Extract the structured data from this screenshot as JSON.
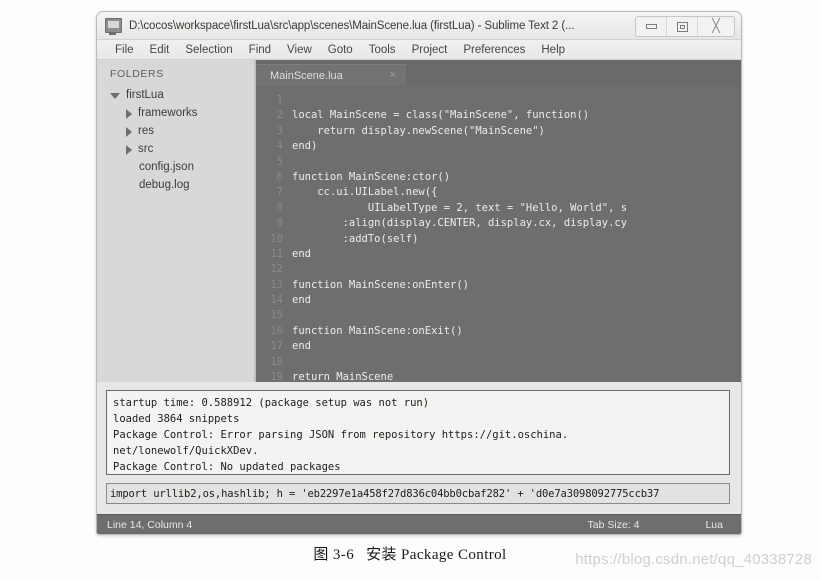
{
  "window": {
    "title": "D:\\cocos\\workspace\\firstLua\\src\\app\\scenes\\MainScene.lua (firstLua) - Sublime Text 2 (...",
    "icon": "app-window-icon",
    "controls": {
      "minimize": "minimize-icon",
      "maximize": "maximize-icon",
      "close": "close-icon"
    }
  },
  "menubar": {
    "items": [
      "File",
      "Edit",
      "Selection",
      "Find",
      "View",
      "Goto",
      "Tools",
      "Project",
      "Preferences",
      "Help"
    ]
  },
  "sidebar": {
    "header": "FOLDERS",
    "tree": [
      {
        "label": "firstLua",
        "level": 1,
        "marker": "triangle-down-icon",
        "expanded": true
      },
      {
        "label": "frameworks",
        "level": 2,
        "marker": "triangle-right-icon",
        "expanded": false
      },
      {
        "label": "res",
        "level": 2,
        "marker": "triangle-right-icon",
        "expanded": false
      },
      {
        "label": "src",
        "level": 2,
        "marker": "triangle-right-icon",
        "expanded": false
      },
      {
        "label": "config.json",
        "level": 2,
        "marker": "none",
        "expanded": false
      },
      {
        "label": "debug.log",
        "level": 2,
        "marker": "none",
        "expanded": false
      }
    ]
  },
  "editor": {
    "tab": {
      "name": "MainScene.lua",
      "close": "×"
    },
    "lines": [
      {
        "n": "1",
        "text": ""
      },
      {
        "n": "2",
        "text": "local MainScene = class(\"MainScene\", function()"
      },
      {
        "n": "3",
        "text": "    return display.newScene(\"MainScene\")"
      },
      {
        "n": "4",
        "text": "end)"
      },
      {
        "n": "5",
        "text": ""
      },
      {
        "n": "6",
        "text": "function MainScene:ctor()"
      },
      {
        "n": "7",
        "text": "    cc.ui.UILabel.new({"
      },
      {
        "n": "8",
        "text": "            UILabelType = 2, text = \"Hello, World\", s"
      },
      {
        "n": "9",
        "text": "        :align(display.CENTER, display.cx, display.cy"
      },
      {
        "n": "10",
        "text": "        :addTo(self)"
      },
      {
        "n": "11",
        "text": "end"
      },
      {
        "n": "12",
        "text": ""
      },
      {
        "n": "13",
        "text": "function MainScene:onEnter()"
      },
      {
        "n": "14",
        "text": "end"
      },
      {
        "n": "15",
        "text": ""
      },
      {
        "n": "16",
        "text": "function MainScene:onExit()"
      },
      {
        "n": "17",
        "text": "end"
      },
      {
        "n": "18",
        "text": ""
      },
      {
        "n": "19",
        "text": "return MainScene"
      }
    ]
  },
  "console": {
    "lines": [
      "startup time: 0.588912 (package setup was not run)",
      "loaded 3864 snippets",
      "Package Control: Error parsing JSON from repository https://git.oschina.",
      "net/lonewolf/QuickXDev.",
      "Package Control: No updated packages"
    ]
  },
  "command_input": {
    "value": "import urllib2,os,hashlib; h = 'eb2297e1a458f27d836c04bb0cbaf282' + 'd0e7a3098092775ccb37",
    "placeholder": ""
  },
  "statusbar": {
    "position": "Line 14, Column 4",
    "tab_size": "Tab Size: 4",
    "language": "Lua"
  },
  "caption": {
    "figure_number": "图 3-6",
    "text": "安装 Package Control"
  },
  "watermark": "https://blog.csdn.net/qq_40338728",
  "colors": {
    "editor_bg": "#6e6e6c",
    "sidebar_bg": "#d8d8d6",
    "chrome_bg": "#e7e7e5",
    "console_bg": "#f3f3f1",
    "page_bg": "#fdfdfd"
  }
}
